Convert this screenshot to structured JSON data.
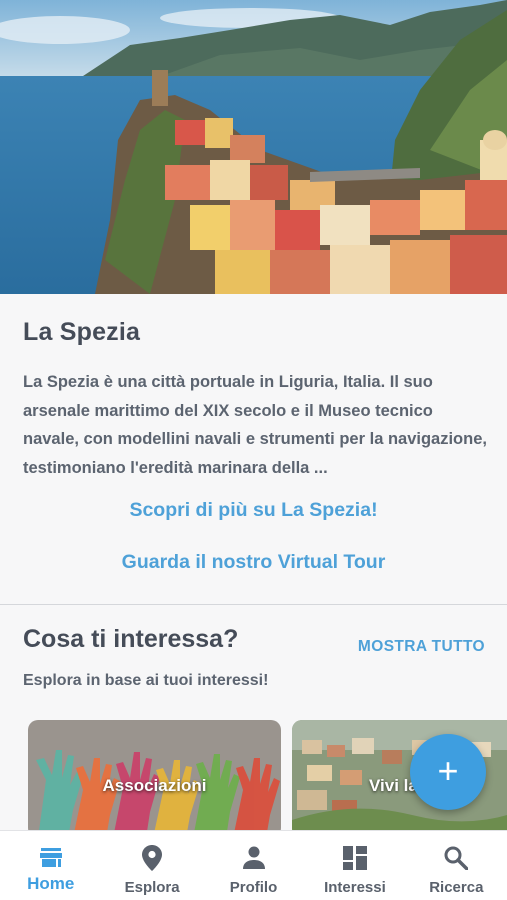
{
  "hero": {
    "image_name": "cinque-terre-village-photo"
  },
  "city": {
    "title": "La Spezia",
    "description": "La Spezia è una città portuale in Liguria, Italia. Il suo arsenale marittimo del XIX secolo e il Museo tecnico navale, con modellini navali e strumenti per la navigazione, testimoniano l'eredità marinara della ...",
    "more_link": "Scopri di più su La Spezia!",
    "tour_link": "Guarda il nostro Virtual Tour"
  },
  "interests": {
    "title": "Cosa ti interessa?",
    "show_all": "MOSTRA TUTTO",
    "subtitle": "Esplora in base ai tuoi interessi!",
    "cards": [
      {
        "label": "Associazioni",
        "image": "hands-image"
      },
      {
        "label": "Vivi la",
        "image": "city-aerial-image"
      }
    ]
  },
  "fab": {
    "symbol": "+"
  },
  "nav": {
    "items": [
      {
        "label": "Home",
        "icon": "store-icon",
        "active": true
      },
      {
        "label": "Esplora",
        "icon": "location-pin-icon",
        "active": false
      },
      {
        "label": "Profilo",
        "icon": "person-icon",
        "active": false
      },
      {
        "label": "Interessi",
        "icon": "dashboard-icon",
        "active": false
      },
      {
        "label": "Ricerca",
        "icon": "search-icon",
        "active": false
      }
    ]
  },
  "colors": {
    "accent": "#3e9ee0",
    "link": "#4ea1d8",
    "text": "#454c58"
  }
}
